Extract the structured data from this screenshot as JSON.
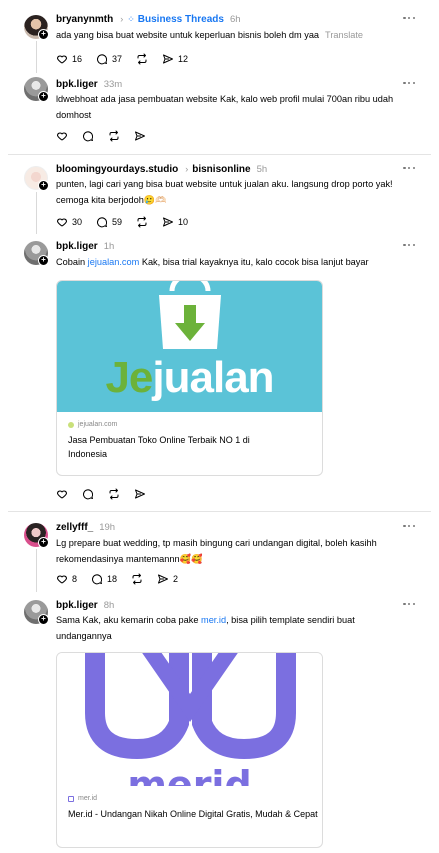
{
  "posts": [
    {
      "username": "bryanynmth",
      "community": "Business Threads",
      "time": "6h",
      "text": "ada yang bisa buat website untuk keperluan bisnis boleh dm yaa",
      "translate": "Translate",
      "likes": "16",
      "comments": "37",
      "reposts": "",
      "shares": "12"
    },
    {
      "username": "bpk.liger",
      "time": "33m",
      "text": "ldwebhoat ada jasa pembuatan website Kak, kalo web profil mulai 700an ribu udah domhost"
    },
    {
      "username": "bloomingyourdays.studio",
      "community": "bisnisonline",
      "time": "5h",
      "text": "punten, lagi cari yang bisa buat website untuk jualan aku. langsung drop porto yak! cemoga kita berjodoh🥲🫶🏻",
      "likes": "30",
      "comments": "59",
      "shares": "10"
    },
    {
      "username": "bpk.liger",
      "time": "1h",
      "text_before": "Cobain ",
      "link": "jejualan.com",
      "text_after": " Kak, bisa trial kayaknya itu, kalo cocok bisa lanjut bayar",
      "card": {
        "logo_je": "Je",
        "logo_rest": "jualan",
        "domain": "jejualan.com",
        "title": "Jasa Pembuatan Toko Online Terbaik NO 1 di Indonesia"
      }
    },
    {
      "username": "zellyfff_",
      "time": "19h",
      "text": "Lg prepare buat wedding, tp masih bingung cari undangan digital, boleh kasihh rekomendasinya mantemannn🥰🥰",
      "likes": "8",
      "comments": "18",
      "shares": "2"
    },
    {
      "username": "bpk.liger",
      "time": "8h",
      "text_before": "Sama Kak, aku kemarin coba pake ",
      "link": "mer.id",
      "text_after": ", bisa pilih template sendiri buat undangannya",
      "card": {
        "logo_text": "merid",
        "domain": "mer.id",
        "title": "Mer.id - Undangan Nikah Online Digital Gratis, Mudah & Cepat"
      }
    }
  ],
  "colors": {
    "link": "#1877f2",
    "jejualan_bg": "#5bc3d7",
    "jejualan_green": "#6cb23a",
    "merid_purple": "#7b6fe0"
  },
  "icons": [
    "heart-icon",
    "comment-icon",
    "repost-icon",
    "share-icon",
    "more-icon",
    "plus-icon"
  ]
}
